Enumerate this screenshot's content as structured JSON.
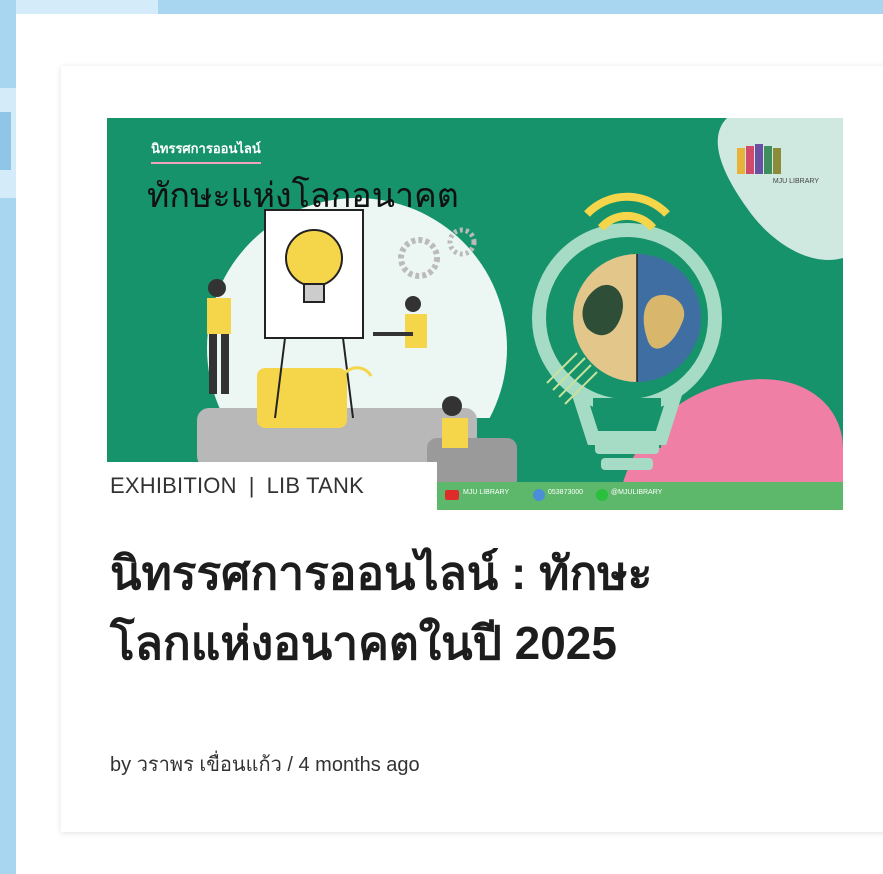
{
  "post": {
    "categories": [
      "EXHIBITION",
      "LIB TANK"
    ],
    "separator": "|",
    "title_line1": "นิทรรศการออนไลน์ : ทักษะ",
    "title_line2": "โลกแห่งอนาคตในปี 2025",
    "meta_by": "by",
    "author": "วราพร เขื่อนแก้ว",
    "meta_sep": "/",
    "date": "4 months ago"
  },
  "thumbnail": {
    "small_title": "นิทรรศการออนไลน์",
    "big_title": "ทักษะแห่งโลกอนาคต",
    "brand": "MJU LIBRARY",
    "footer_youtube": "MJU LIBRARY",
    "footer_phone": "053873000",
    "footer_line": "@MJULIBRARY"
  },
  "colors": {
    "thumb_green": "#16936a",
    "thumb_footer_green": "#5db86b",
    "accent_pink": "#ef7fa5",
    "bulb_mint": "#a6dcc6",
    "bulb_yellow": "#f5d64a",
    "page_bg_blue": "#a8d6f1"
  }
}
